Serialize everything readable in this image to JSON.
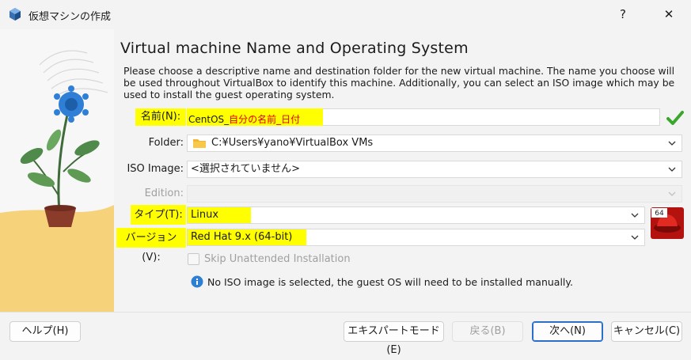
{
  "window": {
    "title": "仮想マシンの作成",
    "help_label": "?",
    "close_label": "✕"
  },
  "page": {
    "heading": "Virtual machine Name and Operating System",
    "description": "Please choose a descriptive name and destination folder for the new virtual machine. The name you choose will be used throughout VirtualBox to identify this machine. Additionally, you can select an ISO image which may be used to install the guest operating system."
  },
  "form": {
    "name": {
      "label": "名前(N):",
      "value_prefix": "CentOS_",
      "value_suffix": "自分の名前_日付"
    },
    "folder": {
      "label": "Folder:",
      "value": "C:¥Users¥yano¥VirtualBox VMs"
    },
    "iso": {
      "label": "ISO Image:",
      "value": "<選択されていません>"
    },
    "edition": {
      "label": "Edition:",
      "value": ""
    },
    "type": {
      "label": "タイプ(T):",
      "value": "Linux"
    },
    "version": {
      "label": "バージョン(V):",
      "value": "Red Hat 9.x (64-bit)"
    },
    "os_badge": "64",
    "skip_unattended": {
      "label": "Skip Unattended Installation",
      "checked": false
    },
    "info_message": "No ISO image is selected, the guest OS will need to be installed manually."
  },
  "buttons": {
    "help": "ヘルプ(H)",
    "expert": "エキスパートモード(E)",
    "back": "戻る(B)",
    "next": "次へ(N)",
    "cancel": "キャンセル(C)"
  },
  "colors": {
    "highlight": "#ffff00",
    "name_suffix": "#e00000",
    "default_button_border": "#2b6fc9"
  }
}
